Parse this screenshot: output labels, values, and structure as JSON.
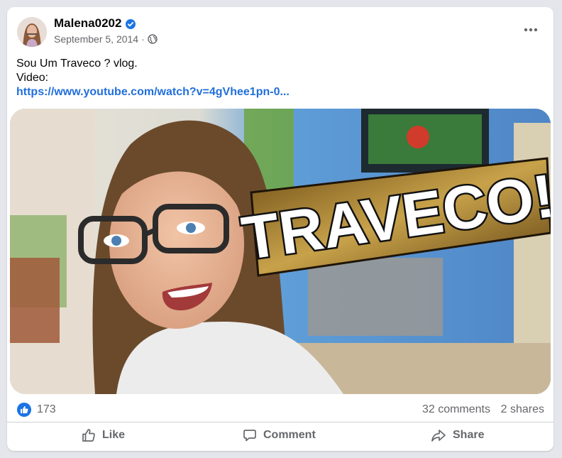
{
  "post": {
    "author": "Malena0202",
    "date": "September 5, 2014",
    "separator": "·",
    "text_line1": "Sou Um Traveco ? vlog.",
    "text_line2": "Video:",
    "link": "https://www.youtube.com/watch?v=4gVhee1pn-0...",
    "thumbnail_overlay_text": "TRAVECO!"
  },
  "stats": {
    "likes": "173",
    "comments": "32 comments",
    "shares": "2 shares"
  },
  "actions": {
    "like": "Like",
    "comment": "Comment",
    "share": "Share"
  },
  "icons": {
    "verified": "verified-badge-icon",
    "privacy": "globe-icon",
    "more": "more-options-icon",
    "like_reaction": "thumbs-up-icon",
    "like_action": "thumbs-up-outline-icon",
    "comment_action": "comment-bubble-icon",
    "share_action": "share-arrow-icon"
  },
  "colors": {
    "link": "#216fdb",
    "secondary_text": "#65676b",
    "like_blue": "#1b74e4",
    "verified_blue": "#1b74e4"
  }
}
